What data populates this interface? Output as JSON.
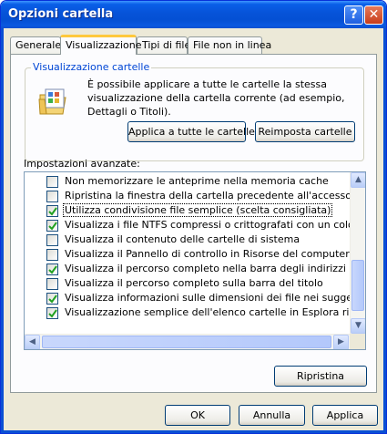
{
  "window": {
    "title": "Opzioni cartella",
    "help_label": "?",
    "close_label": "✕"
  },
  "tabs": [
    {
      "label": "Generale"
    },
    {
      "label": "Visualizzazione"
    },
    {
      "label": "Tipi di file"
    },
    {
      "label": "File non in linea"
    }
  ],
  "folder_views": {
    "group_title": "Visualizzazione cartelle",
    "description": "È possibile applicare a tutte le cartelle la stessa visualizzazione della cartella corrente (ad esempio, Dettagli o Titoli).",
    "apply_all_label": "Applica a tutte le cartelle",
    "reset_label": "Reimposta cartelle"
  },
  "advanced": {
    "label": "Impostazioni avanzate:",
    "items": [
      {
        "label": "Non memorizzare le anteprime nella memoria cache",
        "checked": false
      },
      {
        "label": "Ripristina la finestra della cartella precedente all'accesso",
        "checked": false
      },
      {
        "label": "Utilizza condivisione file semplice (scelta consigliata)",
        "checked": true
      },
      {
        "label": "Visualizza i file NTFS compressi o crittografati con un colore diverso",
        "checked": true
      },
      {
        "label": "Visualizza il contenuto delle cartelle di sistema",
        "checked": false
      },
      {
        "label": "Visualizza il Pannello di controllo in Risorse del computer",
        "checked": false
      },
      {
        "label": "Visualizza il percorso completo nella barra degli indirizzi",
        "checked": true
      },
      {
        "label": "Visualizza il percorso completo sulla barra del titolo",
        "checked": false
      },
      {
        "label": "Visualizza informazioni sulle dimensioni dei file nei suggerimenti della",
        "checked": true
      },
      {
        "label": "Visualizzazione semplice dell'elenco cartelle in Esplora risorse",
        "checked": true
      }
    ],
    "restore_label": "Ripristina"
  },
  "footer": {
    "ok_label": "OK",
    "cancel_label": "Annulla",
    "apply_label": "Applica"
  },
  "colors": {
    "title_bar": "#0653d8",
    "group_title": "#0046d5",
    "check": "#21a121"
  }
}
